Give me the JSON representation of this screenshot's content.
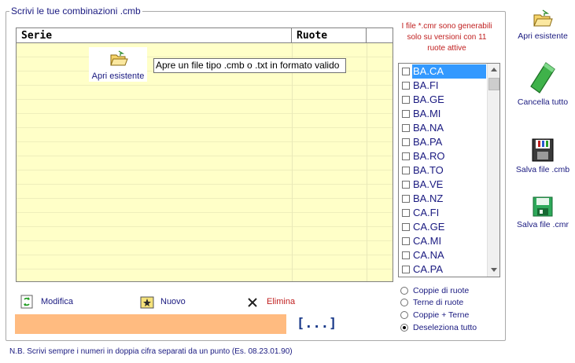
{
  "group": {
    "title": "Scrivi le tue combinazioni .cmb"
  },
  "grid": {
    "col_serie": "Serie",
    "col_ruote": "Ruote"
  },
  "open_button": {
    "label": "Apri esistente"
  },
  "tooltip": {
    "text": "Apre un file tipo .cmb o .txt in formato valido"
  },
  "note": {
    "line1": "I file *.cmr sono generabili",
    "line2": "solo su versioni con 11",
    "line3": "ruote attive"
  },
  "ruote_list": [
    {
      "label": "BA.CA",
      "checked": false,
      "selected": true
    },
    {
      "label": "BA.FI",
      "checked": false
    },
    {
      "label": "BA.GE",
      "checked": false
    },
    {
      "label": "BA.MI",
      "checked": false
    },
    {
      "label": "BA.NA",
      "checked": false
    },
    {
      "label": "BA.PA",
      "checked": false
    },
    {
      "label": "BA.RO",
      "checked": false
    },
    {
      "label": "BA.TO",
      "checked": false
    },
    {
      "label": "BA.VE",
      "checked": false
    },
    {
      "label": "BA.NZ",
      "checked": false
    },
    {
      "label": "CA.FI",
      "checked": false
    },
    {
      "label": "CA.GE",
      "checked": false
    },
    {
      "label": "CA.MI",
      "checked": false
    },
    {
      "label": "CA.NA",
      "checked": false
    },
    {
      "label": "CA.PA",
      "checked": false
    }
  ],
  "radios": [
    {
      "label": "Coppie di ruote",
      "checked": false
    },
    {
      "label": "Terne di ruote",
      "checked": false
    },
    {
      "label": "Coppie + Terne",
      "checked": false
    },
    {
      "label": "Deseleziona tutto",
      "checked": true
    }
  ],
  "actions": {
    "modifica": "Modifica",
    "nuovo": "Nuovo",
    "elimina": "Elimina"
  },
  "browse": {
    "label": "[...]"
  },
  "footer": {
    "note": "N.B. Scrivi sempre i numeri in doppia cifra separati da un punto (Es. 08.23.01.90)"
  },
  "side": {
    "apri": "Apri esistente",
    "cancella": "Cancella tutto",
    "salva_cmb": "Salva file .cmb",
    "salva_cmr": "Salva file .cmr"
  },
  "colors": {
    "text": "#1a1a80",
    "grid_bg": "#ffffc8",
    "progress": "#ffbb80",
    "selection": "#3399ff",
    "delete": "#c02020"
  }
}
